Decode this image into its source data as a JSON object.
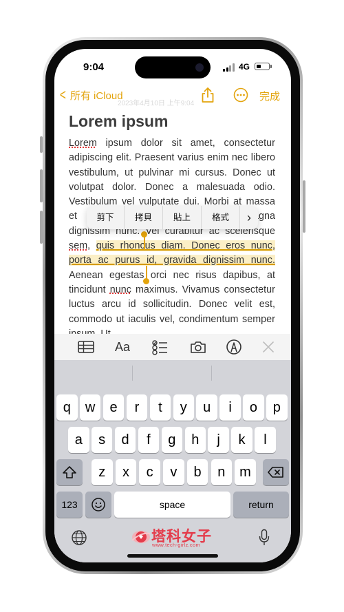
{
  "status_bar": {
    "time": "9:04",
    "network": "4G"
  },
  "nav": {
    "back_label": "所有 iCloud",
    "date_faint": "2023年4月10日 上午9:04",
    "done_label": "完成"
  },
  "note": {
    "title": "Lorem ipsum",
    "segments": {
      "s1": "Lorem",
      "s2": " ipsum dolor sit amet, consectetur adipiscing elit. Praesent varius enim nec libero vestibulum, ut pulvinar mi cursus. Donec ut volutpat dolor. Donec a malesuada odio. Vestibulum vel vulputate dui. Morbi at massa et lectus mattis commodo tortor magna dignissim nunc. Vel curabitur ac scelerisque ",
      "s3": "sem",
      "s4": ", ",
      "s5": "quis rhoncus diam. Donec eros nunc, porta ac purus id, gravida dignissim nunc.",
      "s6": " Aenean egestas orci nec risus dapibus, at tincidunt ",
      "s7": "nunc",
      "s8": " maximus. Vivamus consectetur luctus arcu id sollicitudin. Donec velit est, commodo ut iaculis vel, condimentum semper ipsum. Ut"
    }
  },
  "edit_menu": {
    "cut": "剪下",
    "copy": "拷貝",
    "paste": "貼上",
    "format": "格式",
    "more": "›"
  },
  "toolbar": {
    "text_style_label": "Aa"
  },
  "keyboard": {
    "row1": [
      "q",
      "w",
      "e",
      "r",
      "t",
      "y",
      "u",
      "i",
      "o",
      "p"
    ],
    "row2": [
      "a",
      "s",
      "d",
      "f",
      "g",
      "h",
      "j",
      "k",
      "l"
    ],
    "row3": [
      "z",
      "x",
      "c",
      "v",
      "b",
      "n",
      "m"
    ],
    "numbers_label": "123",
    "space_label": "space",
    "return_label": "return"
  },
  "watermark": {
    "name": "塔科女子",
    "url": "www.tech-girlz.com"
  },
  "colors": {
    "accent": "#e3a40d",
    "highlight": "#fbefc6",
    "keyboard_bg": "#d3d4d9",
    "brand": "#e43c4b"
  }
}
